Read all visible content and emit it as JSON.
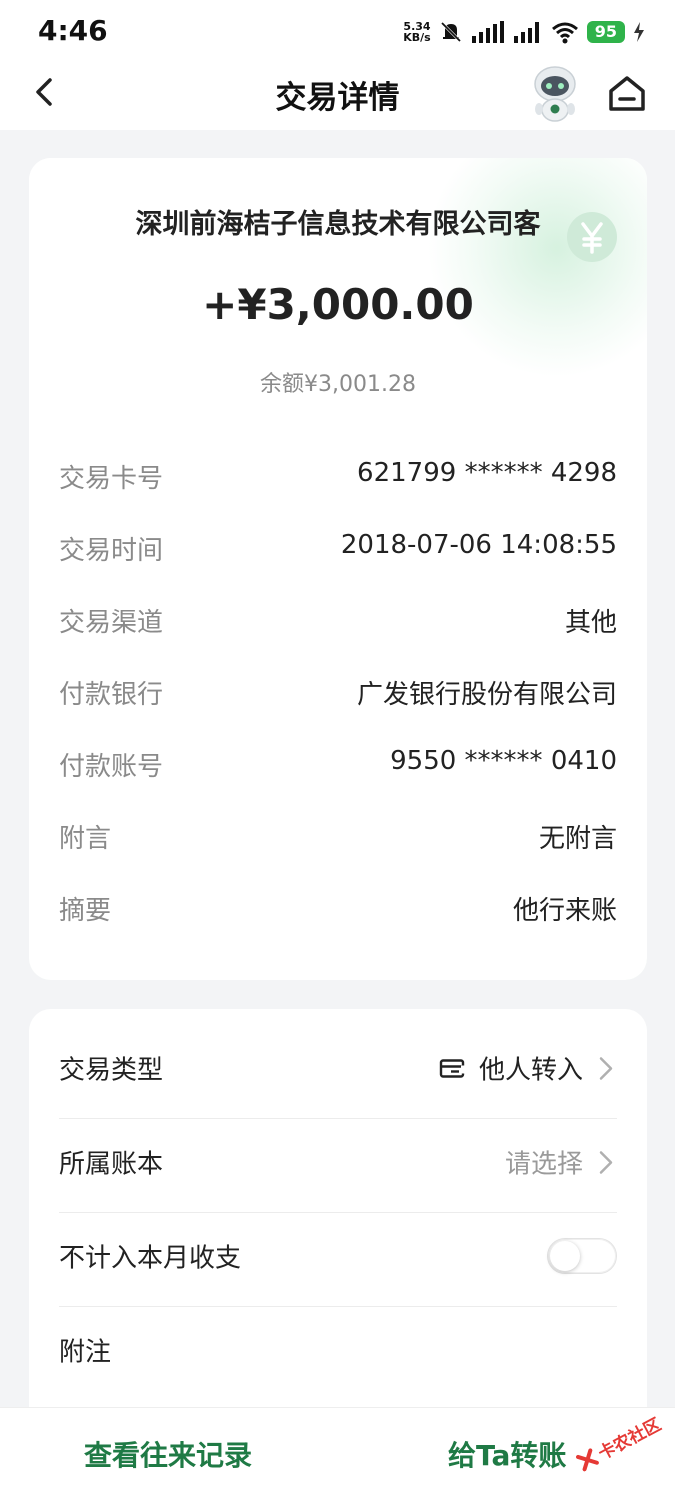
{
  "status_bar": {
    "time": "4:46",
    "net_speed_value": "5.34",
    "net_speed_unit": "KB/s",
    "battery": "95"
  },
  "header": {
    "title": "交易详情"
  },
  "summary": {
    "merchant": "深圳前海桔子信息技术有限公司客",
    "amount": "+¥3,000.00",
    "balance": "余额¥3,001.28"
  },
  "details": [
    {
      "label": "交易卡号",
      "value": "621799 ****** 4298"
    },
    {
      "label": "交易时间",
      "value": "2018-07-06 14:08:55"
    },
    {
      "label": "交易渠道",
      "value": "其他"
    },
    {
      "label": "付款银行",
      "value": "广发银行股份有限公司"
    },
    {
      "label": "付款账号",
      "value": "9550 ****** 0410"
    },
    {
      "label": "附言",
      "value": "无附言"
    },
    {
      "label": "摘要",
      "value": "他行来账"
    }
  ],
  "options": {
    "type_label": "交易类型",
    "type_value": "他人转入",
    "book_label": "所属账本",
    "book_value": "请选择",
    "exclude_label": "不计入本月收支",
    "exclude_on": false,
    "note_label": "附注"
  },
  "bottom": {
    "history": "查看往来记录",
    "transfer": "给Ta转账",
    "watermark": "卡农社区"
  },
  "colors": {
    "accent_green": "#1f7a45",
    "battery_green": "#2fb34a"
  }
}
